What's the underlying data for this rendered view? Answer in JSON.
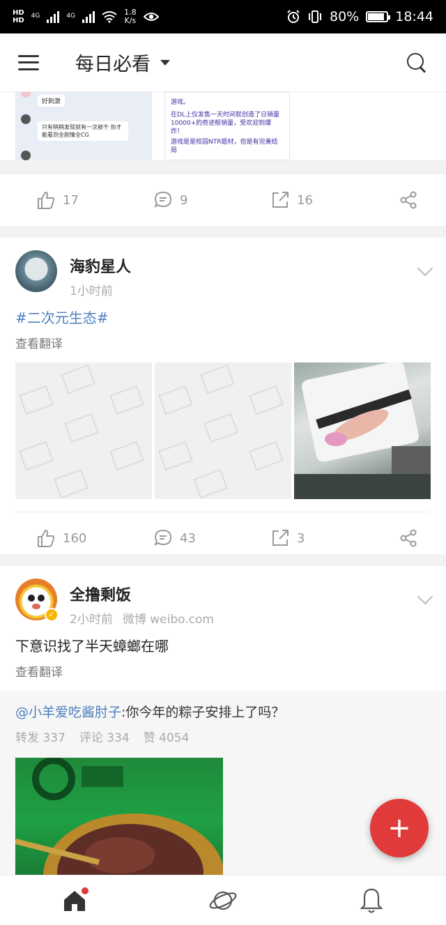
{
  "status_bar": {
    "hd1": "HD",
    "hd2": "HD",
    "net1": "4G",
    "net2": "4G",
    "speed": "1.8",
    "speed_unit": "K/s",
    "battery": "80%",
    "time": "18:44"
  },
  "header": {
    "title": "每日必看"
  },
  "card1": {
    "likes": "17",
    "comments": "9",
    "reposts": "16",
    "image_texts": [
      "好刺激",
      "只有稍稍发现就有一次被干 你才能看到全剧情全CG",
      "游戏。",
      "在DL上仅发售一天时间就创造了日销量10000+的奇迹般销量，受欢迎到爆炸！",
      "游戏是是校园NTR题材，但是有完美结局"
    ]
  },
  "card2": {
    "author": "海豹星人",
    "time": "1小时前",
    "topic": "#二次元生态#",
    "translate": "查看翻译",
    "likes": "160",
    "comments": "43",
    "reposts": "3"
  },
  "card3": {
    "author": "全撸剩饭",
    "time": "2小时前",
    "source": "微博 weibo.com",
    "text": "下意识找了半天蟑螂在哪",
    "translate": "查看翻译",
    "repost_user": "@小羊爱吃酱肘子",
    "repost_text": ":你今年的粽子安排上了吗？",
    "repost_count": "转发 337",
    "comment_count": "评论 334",
    "like_count": "赞 4054"
  },
  "colors": {
    "accent": "#e03a3a",
    "link": "#4d7fbd"
  }
}
